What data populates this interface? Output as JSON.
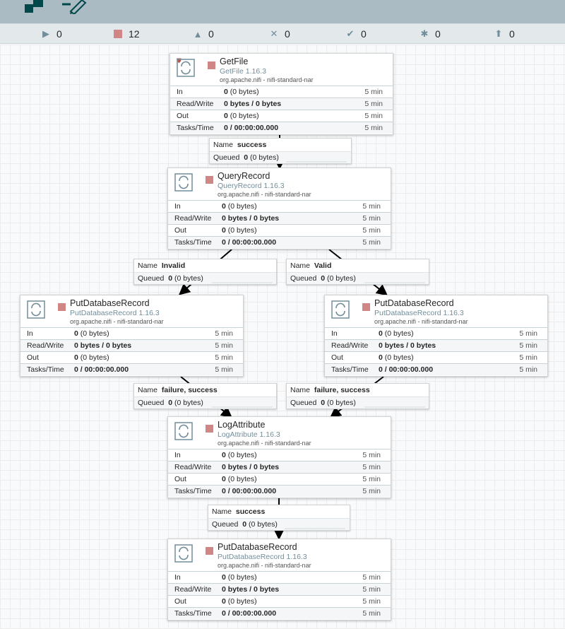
{
  "status_bar": {
    "running": "0",
    "stopped": "12",
    "invalid": "0",
    "disabled": "0",
    "up_to_date": "0",
    "locally_modified": "0",
    "stale": "0"
  },
  "processors": [
    {
      "name": "GetFile",
      "type_version": "GetFile 1.16.3",
      "bundle": "org.apache.nifi - nifi-standard-nar",
      "in": "0",
      "in_bytes": "(0 bytes)",
      "read_write": "0 bytes / 0 bytes",
      "out": "0",
      "out_bytes": "(0 bytes)",
      "tasks_time": "0 / 00:00:00.000",
      "window": "5 min"
    },
    {
      "name": "QueryRecord",
      "type_version": "QueryRecord 1.16.3",
      "bundle": "org.apache.nifi - nifi-standard-nar",
      "in": "0",
      "in_bytes": "(0 bytes)",
      "read_write": "0 bytes / 0 bytes",
      "out": "0",
      "out_bytes": "(0 bytes)",
      "tasks_time": "0 / 00:00:00.000",
      "window": "5 min"
    },
    {
      "name": "PutDatabaseRecord",
      "type_version": "PutDatabaseRecord 1.16.3",
      "bundle": "org.apache.nifi - nifi-standard-nar",
      "in": "0",
      "in_bytes": "(0 bytes)",
      "read_write": "0 bytes / 0 bytes",
      "out": "0",
      "out_bytes": "(0 bytes)",
      "tasks_time": "0 / 00:00:00.000",
      "window": "5 min"
    },
    {
      "name": "PutDatabaseRecord",
      "type_version": "PutDatabaseRecord 1.16.3",
      "bundle": "org.apache.nifi - nifi-standard-nar",
      "in": "0",
      "in_bytes": "(0 bytes)",
      "read_write": "0 bytes / 0 bytes",
      "out": "0",
      "out_bytes": "(0 bytes)",
      "tasks_time": "0 / 00:00:00.000",
      "window": "5 min"
    },
    {
      "name": "LogAttribute",
      "type_version": "LogAttribute 1.16.3",
      "bundle": "org.apache.nifi - nifi-standard-nar",
      "in": "0",
      "in_bytes": "(0 bytes)",
      "read_write": "0 bytes / 0 bytes",
      "out": "0",
      "out_bytes": "(0 bytes)",
      "tasks_time": "0 / 00:00:00.000",
      "window": "5 min"
    },
    {
      "name": "PutDatabaseRecord",
      "type_version": "PutDatabaseRecord 1.16.3",
      "bundle": "org.apache.nifi - nifi-standard-nar",
      "in": "0",
      "in_bytes": "(0 bytes)",
      "read_write": "0 bytes / 0 bytes",
      "out": "0",
      "out_bytes": "(0 bytes)",
      "tasks_time": "0 / 00:00:00.000",
      "window": "5 min"
    }
  ],
  "labels": {
    "in": "In",
    "read_write": "Read/Write",
    "out": "Out",
    "tasks_time": "Tasks/Time",
    "name": "Name",
    "queued": "Queued"
  },
  "connections": [
    {
      "name": "success",
      "queued_count": "0",
      "queued_bytes": "(0 bytes)"
    },
    {
      "name": "Invalid",
      "queued_count": "0",
      "queued_bytes": "(0 bytes)"
    },
    {
      "name": "Valid",
      "queued_count": "0",
      "queued_bytes": "(0 bytes)"
    },
    {
      "name": "failure, success",
      "queued_count": "0",
      "queued_bytes": "(0 bytes)"
    },
    {
      "name": "failure, success",
      "queued_count": "0",
      "queued_bytes": "(0 bytes)"
    },
    {
      "name": "success",
      "queued_count": "0",
      "queued_bytes": "(0 bytes)"
    }
  ],
  "colors": {
    "header": "#aabbc3",
    "status_bar": "#e3e8eb",
    "stopped": "#d18686",
    "accent": "#728e9b"
  }
}
